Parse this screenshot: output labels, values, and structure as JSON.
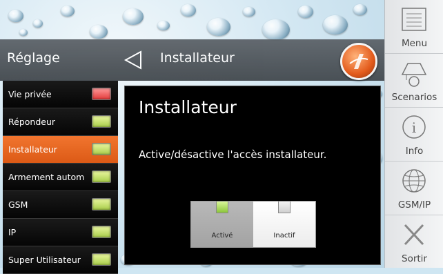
{
  "header": {
    "title": "Réglage",
    "subtitle": "Installateur"
  },
  "settings": [
    {
      "label": "Vie privée",
      "state": "red"
    },
    {
      "label": "Répondeur",
      "state": "green"
    },
    {
      "label": "Installateur",
      "state": "green"
    },
    {
      "label": "Armement autom",
      "state": "green"
    },
    {
      "label": "GSM",
      "state": "green"
    },
    {
      "label": "IP",
      "state": "green"
    },
    {
      "label": "Super Utilisateur",
      "state": "green"
    }
  ],
  "dialog": {
    "title": "Installateur",
    "description": "Active/désactive l'accès installateur.",
    "on_label": "Activé",
    "off_label": "Inactif"
  },
  "rail": {
    "menu": "Menu",
    "scenarios": "Scenarios",
    "info": "Info",
    "gsmip": "GSM/IP",
    "exit": "Sortir"
  },
  "colors": {
    "accent": "#e8661f",
    "led_green": "#a8cd4a",
    "led_red": "#e33a3a",
    "dialog_bg": "#000000"
  }
}
